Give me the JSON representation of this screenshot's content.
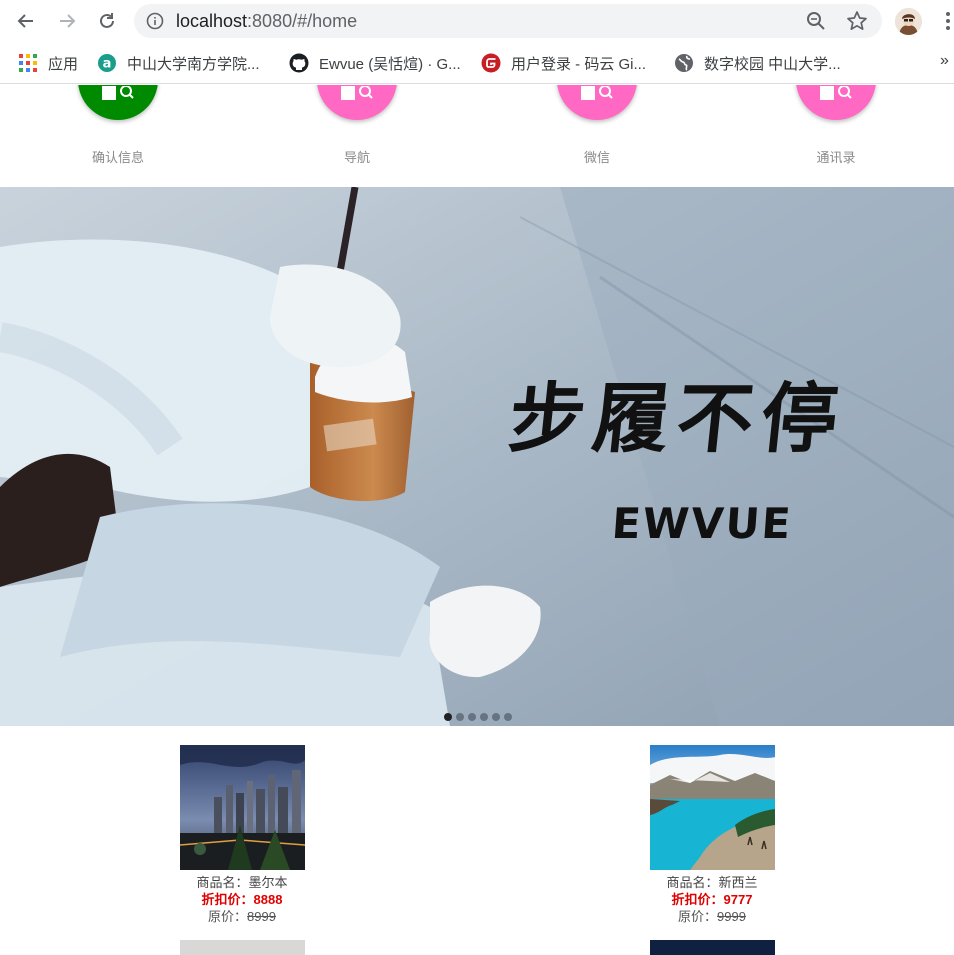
{
  "browser": {
    "url_host": "localhost",
    "url_rest": ":8080/#/home",
    "bookmarks": [
      {
        "label": "应用",
        "icon": "apps-grid-icon"
      },
      {
        "label": "中山大学南方学院...",
        "icon": "school-logo-icon"
      },
      {
        "label": "Ewvue (吴恬煊) · G...",
        "icon": "github-icon"
      },
      {
        "label": "用户登录 - 码云 Gi...",
        "icon": "gitee-icon"
      },
      {
        "label": "数字校园 中山大学...",
        "icon": "globe-icon"
      }
    ],
    "more_bookmarks": "»"
  },
  "grid_menu": [
    {
      "label": "确认信息",
      "color": "#008a00"
    },
    {
      "label": "导航",
      "color": "#ff69c4"
    },
    {
      "label": "微信",
      "color": "#ff69c4"
    },
    {
      "label": "通讯录",
      "color": "#ff69c4"
    }
  ],
  "banner": {
    "title": "步履不停",
    "subtitle": "EWVUE",
    "dot_count": 6,
    "active_dot": 0
  },
  "products": [
    {
      "name_label": "商品名：",
      "name": "墨尔本",
      "discount_label": "折扣价：",
      "discount": "8888",
      "original_label": "原价：",
      "original": "8999"
    },
    {
      "name_label": "商品名：",
      "name": "新西兰",
      "discount_label": "折扣价：",
      "discount": "9777",
      "original_label": "原价：",
      "original": "9999"
    }
  ]
}
